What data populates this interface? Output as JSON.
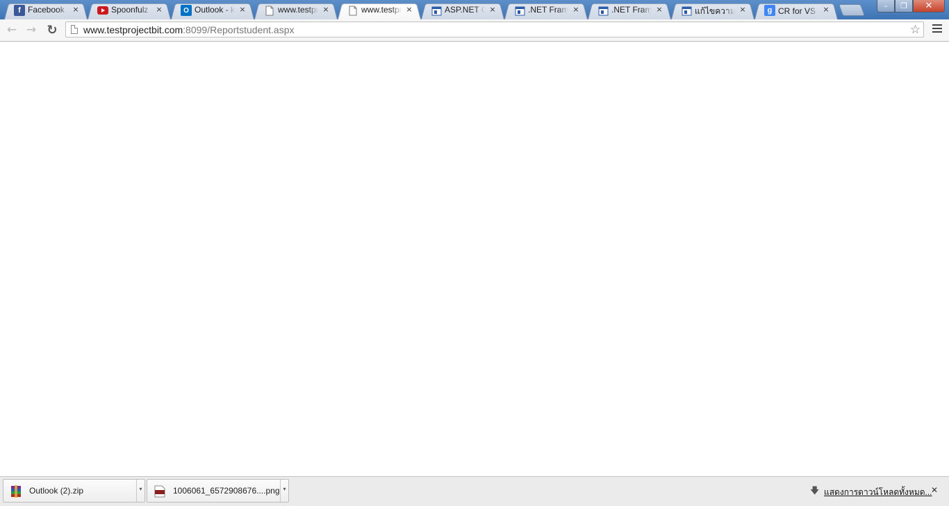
{
  "tabs": [
    {
      "title": "Facebook",
      "icon": "facebook-icon",
      "active": false
    },
    {
      "title": "Spoonfulz -",
      "icon": "youtube-icon",
      "active": false
    },
    {
      "title": "Outlook - ka",
      "icon": "outlook-icon",
      "active": false
    },
    {
      "title": "www.testpro",
      "icon": "page-icon",
      "active": false
    },
    {
      "title": "www.testpro",
      "icon": "page-icon",
      "active": true
    },
    {
      "title": "ASP.NET Ch",
      "icon": "msdn-icon",
      "active": false
    },
    {
      "title": ".NET Frame",
      "icon": "msdn-icon",
      "active": false
    },
    {
      "title": ".NET Frame",
      "icon": "msdn-icon",
      "active": false
    },
    {
      "title": "แก้ไขความคิด",
      "icon": "msdn-icon",
      "active": false
    },
    {
      "title": "CR for VS กับ",
      "icon": "google-icon",
      "active": false
    }
  ],
  "tab_close_glyph": "×",
  "window": {
    "minimize": "–",
    "maximize": "❐",
    "close": "✕"
  },
  "toolbar": {
    "back_glyph": "←",
    "forward_glyph": "→",
    "reload_glyph": "↻",
    "url_host": "www.testprojectbit.com",
    "url_rest": ":8099/Reportstudent.aspx",
    "star_glyph": "☆"
  },
  "downloads": {
    "items": [
      {
        "filename": "Outlook (2).zip",
        "icon": "winrar-archive-icon"
      },
      {
        "filename": "1006061_6572908676....png",
        "icon": "png-file-icon"
      }
    ],
    "dropdown_glyph": "▾",
    "show_all_label": "แสดงการดาวน์โหลดทั้งหมด...",
    "download_glyph": "🡇",
    "close_glyph": "✕"
  },
  "colors": {
    "titlebar": "#4a7fbe",
    "facebook": "#3b5998",
    "youtube": "#cc181e",
    "outlook": "#0072c6",
    "google": "#4285f4"
  }
}
